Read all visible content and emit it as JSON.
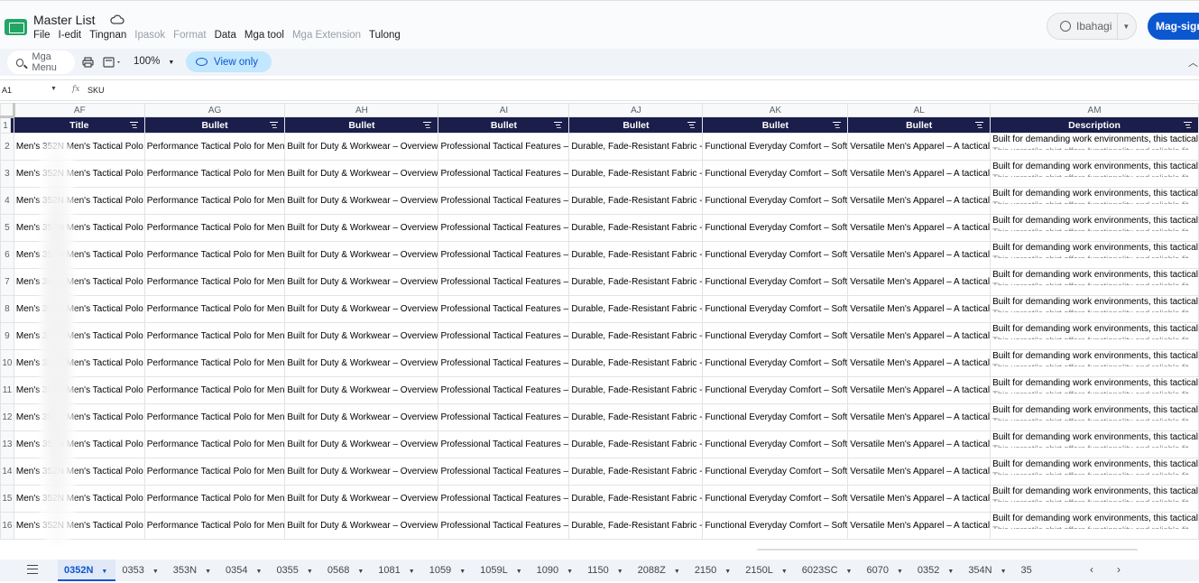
{
  "app": {
    "doc_title": "Master List",
    "menu": [
      {
        "label": "File",
        "disabled": false
      },
      {
        "label": "I-edit",
        "disabled": false
      },
      {
        "label": "Tingnan",
        "disabled": false
      },
      {
        "label": "Ipasok",
        "disabled": true
      },
      {
        "label": "Format",
        "disabled": true
      },
      {
        "label": "Data",
        "disabled": false
      },
      {
        "label": "Mga tool",
        "disabled": false
      },
      {
        "label": "Mga Extension",
        "disabled": true
      },
      {
        "label": "Tulong",
        "disabled": false
      }
    ],
    "language_label": "Ibahagi",
    "signin_label": "Mag-sign in"
  },
  "toolbar": {
    "search_placeholder": "Mga Menu",
    "zoom": "100%",
    "view_only_label": "View only"
  },
  "formula_bar": {
    "cell_ref": "A1",
    "fx": "fx",
    "value": "SKU"
  },
  "grid": {
    "columns": [
      {
        "letter": "AF",
        "header": "Title",
        "cell": "Men's 352N Men's Tactical Polo"
      },
      {
        "letter": "AG",
        "header": "Bullet",
        "cell": "Performance Tactical Polo for Men"
      },
      {
        "letter": "AH",
        "header": "Bullet",
        "cell": "Built for Duty & Workwear – Overview"
      },
      {
        "letter": "AI",
        "header": "Bullet",
        "cell": "Professional Tactical Features –"
      },
      {
        "letter": "AJ",
        "header": "Bullet",
        "cell": "Durable, Fade-Resistant Fabric -"
      },
      {
        "letter": "AK",
        "header": "Bullet",
        "cell": "Functional Everyday Comfort – Soft"
      },
      {
        "letter": "AL",
        "header": "Bullet",
        "cell": "Versatile Men's Apparel – A tactical"
      },
      {
        "letter": "AM",
        "header": "Description",
        "cell": "Built for demanding work environments, this tactical"
      }
    ],
    "row_numbers": [
      "1",
      "2",
      "3",
      "4",
      "5",
      "6",
      "7",
      "8",
      "9",
      "10",
      "11",
      "12",
      "13",
      "14",
      "15",
      "16"
    ],
    "description_second_line": "This versatile shirt offers functionality and reliable fit"
  },
  "sheets": {
    "active": "0352N",
    "tabs": [
      "0352N",
      "0353",
      "353N",
      "0354",
      "0355",
      "0568",
      "1081",
      "1059",
      "1059L",
      "1090",
      "1150",
      "2088Z",
      "2150",
      "2150L",
      "6023SC",
      "6070",
      "0352",
      "354N",
      "35"
    ]
  }
}
